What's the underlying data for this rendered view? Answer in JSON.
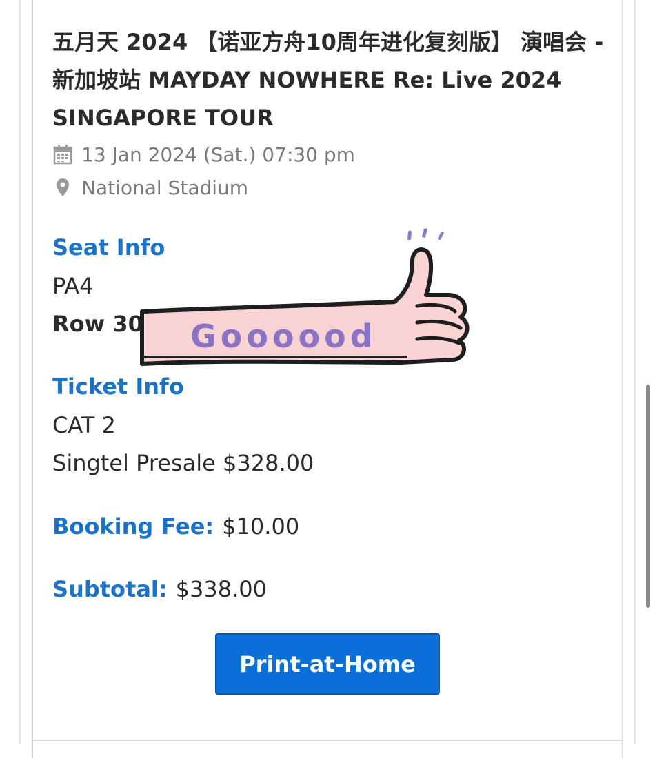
{
  "event": {
    "title": "五月天 2024 【诺亚方舟10周年进化复刻版】 演唱会 - 新加坡站 MAYDAY NOWHERE Re: Live 2024 SINGAPORE TOUR",
    "date_time": "13 Jan 2024 (Sat.) 07:30 pm",
    "venue": "National Stadium"
  },
  "seat_info": {
    "label": "Seat Info",
    "section": "PA4",
    "row": "Row 30"
  },
  "ticket_info": {
    "label": "Ticket Info",
    "category": "CAT 2",
    "price_line": "Singtel Presale $328.00"
  },
  "booking_fee": {
    "label": "Booking Fee:",
    "value": "$10.00"
  },
  "subtotal": {
    "label": "Subtotal:",
    "value": "$338.00"
  },
  "actions": {
    "print_label": "Print-at-Home"
  },
  "sticker": {
    "text": "Goooood",
    "icon": "thumbs-up-sticker"
  },
  "colors": {
    "accent": "#1a73c9",
    "button": "#0a6fd8",
    "muted_text": "#7a7a7a",
    "sticker_fill": "#f9d3d3",
    "sticker_text": "#8a73c6"
  }
}
